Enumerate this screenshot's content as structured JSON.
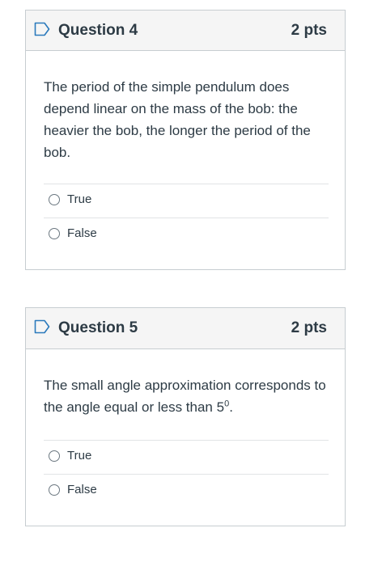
{
  "questions": [
    {
      "title": "Question 4",
      "points": "2 pts",
      "text": "The period of the simple pendulum does depend linear on the mass of the bob: the heavier the bob, the longer the period of the bob.",
      "answers": [
        "True",
        "False"
      ]
    },
    {
      "title": "Question 5",
      "points": "2 pts",
      "text_main": "The small angle approximation corresponds to the angle equal or less than 5",
      "text_sup": "0",
      "text_end": ".",
      "answers": [
        "True",
        "False"
      ]
    }
  ],
  "icons": {
    "flag": "flag-outline-icon",
    "flag_color": "#2b7abc"
  }
}
